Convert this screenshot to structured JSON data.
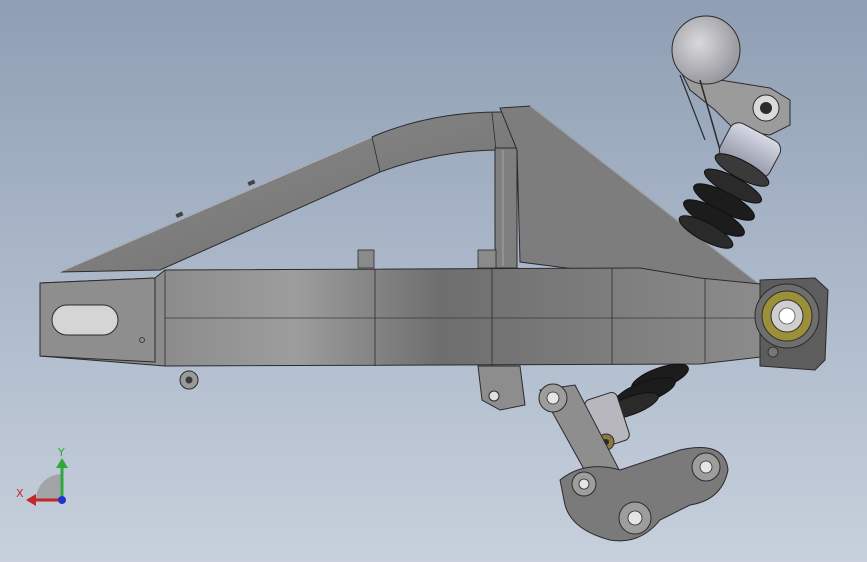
{
  "viewport": {
    "background_top": "#8f9eb3",
    "background_bottom": "#c7d0dc",
    "model": "swingarm-with-shock-and-linkage"
  },
  "triad": {
    "x_label": "X",
    "y_label": "Y",
    "x_color": "#c0282c",
    "y_color": "#2eaa3c",
    "z_color": "#2233cc"
  },
  "colors": {
    "steel_light": "#8f8f8f",
    "steel_mid": "#7a7a7a",
    "steel_dark": "#5e5e5e",
    "edge": "#2b2b2b",
    "spring": "#1c1c1c",
    "reservoir": "#b9bcc8",
    "bushing_gold": "#9c8f3a"
  }
}
